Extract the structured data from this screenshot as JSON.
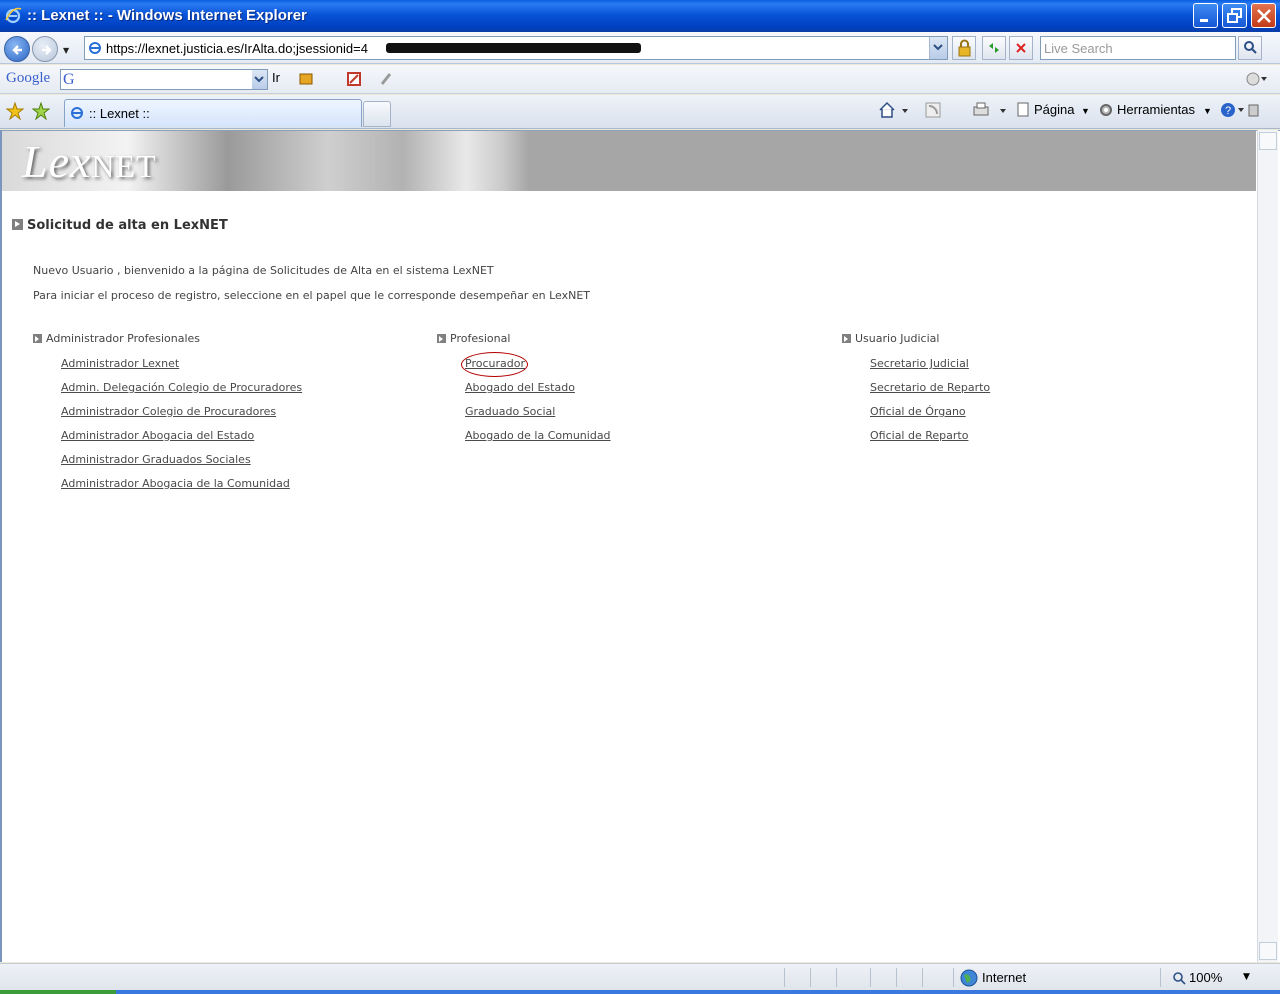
{
  "window": {
    "title": ":: Lexnet :: - Windows Internet Explorer"
  },
  "addressbar": {
    "url": "https://lexnet.justicia.es/IrAlta.do;jsessionid=4",
    "search_placeholder": "Live Search"
  },
  "google_toolbar": {
    "logo": "Google",
    "go_label": "Ir"
  },
  "tabs": [
    {
      "label": ":: Lexnet ::"
    }
  ],
  "commandbar": {
    "page_label": "Página",
    "tools_label": "Herramientas"
  },
  "page": {
    "logo_lex": "Lex",
    "logo_net": "NET",
    "heading": "Solicitud de alta en LexNET",
    "intro_line1": "Nuevo Usuario , bienvenido a la página de Solicitudes de Alta en el sistema LexNET",
    "intro_line2": "Para iniciar el proceso de registro, seleccione en el papel que le corresponde desempeñar en LexNET",
    "columns": [
      {
        "title": "Administrador Profesionales",
        "links": [
          "Administrador Lexnet",
          "Admin. Delegación Colegio de Procuradores",
          "Administrador Colegio de Procuradores",
          "Administrador Abogacia del Estado",
          "Administrador Graduados Sociales",
          "Administrador Abogacia de la Comunidad"
        ]
      },
      {
        "title": "Profesional",
        "links": [
          "Procurador",
          "Abogado del Estado",
          "Graduado Social",
          "Abogado de la Comunidad"
        ]
      },
      {
        "title": "Usuario Judicial",
        "links": [
          "Secretario Judicial",
          "Secretario de Reparto",
          "Oficial de Órgano",
          "Oficial de Reparto"
        ]
      }
    ]
  },
  "statusbar": {
    "zone": "Internet",
    "zoom": "100%"
  },
  "colors": {
    "titlebar": "#0954d8",
    "banner_gray": "#a6a6a6",
    "highlight_circle": "#b30000",
    "link_text": "#4a4a4a"
  }
}
